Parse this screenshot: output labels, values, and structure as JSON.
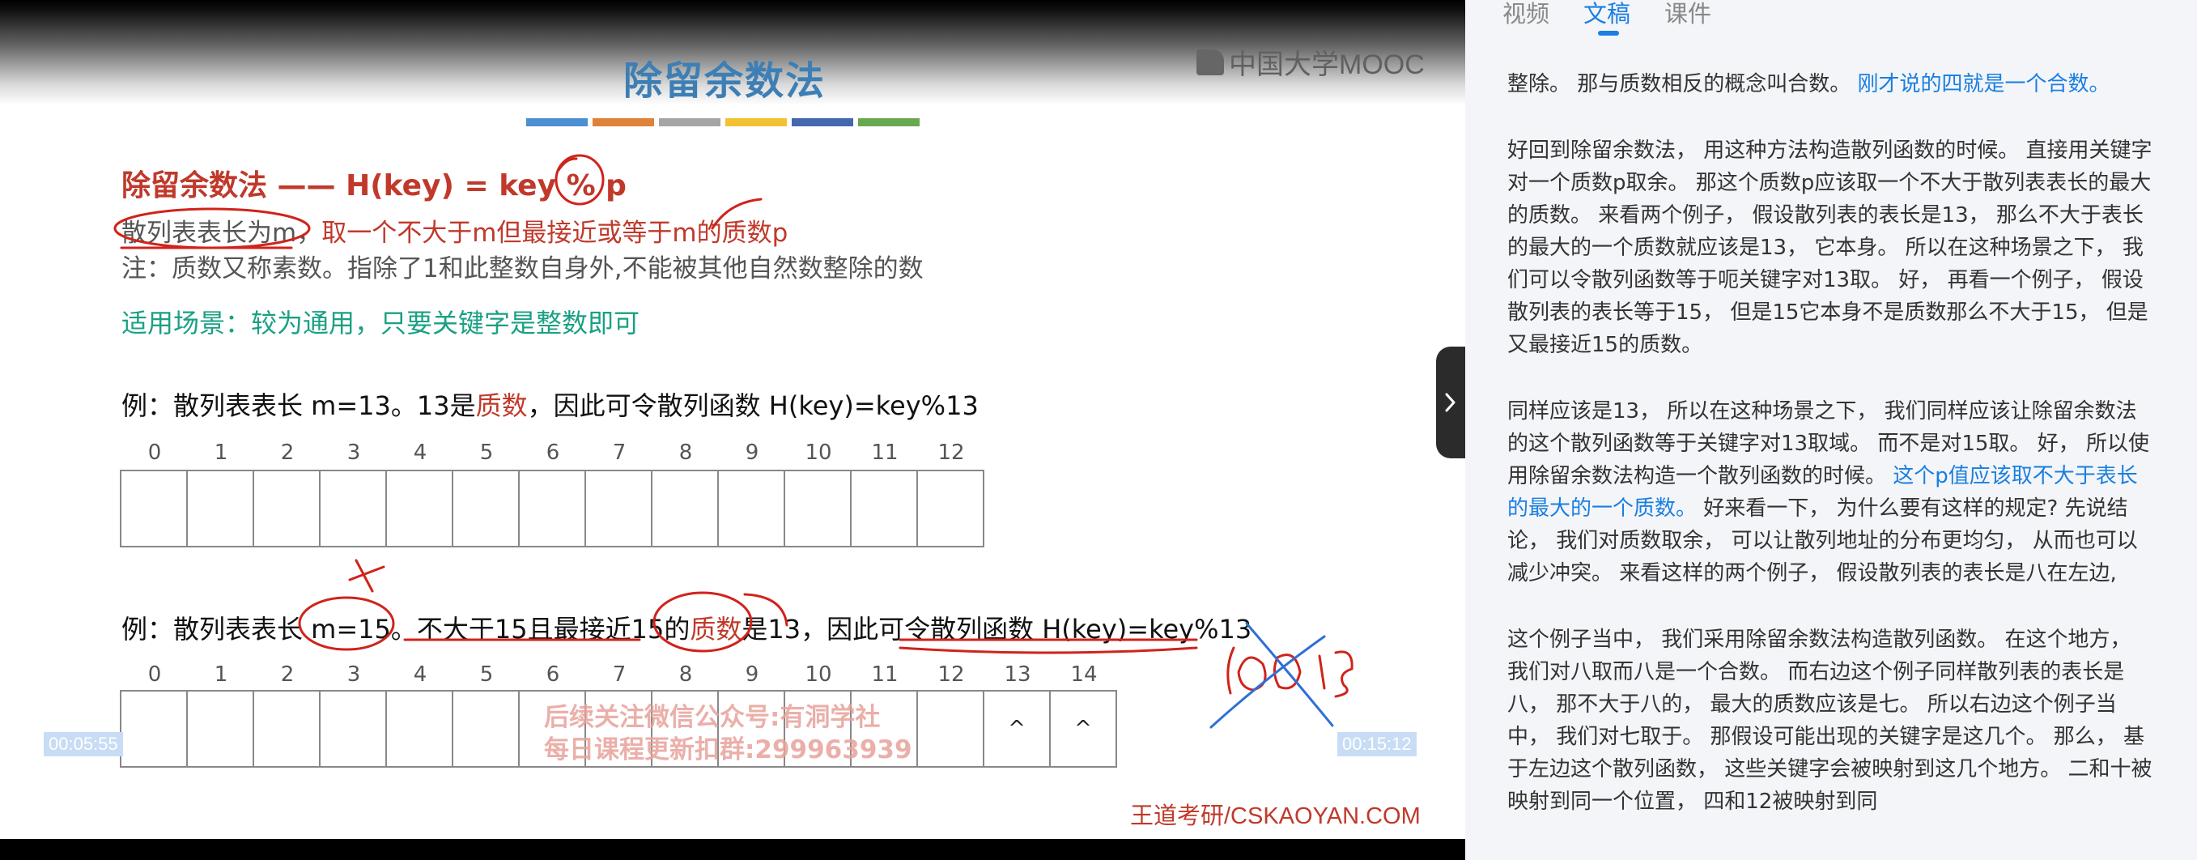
{
  "slide": {
    "title": "除留余数法",
    "formula": "除留余数法 —— H(key) = key % p",
    "line2_pre": "散列表表长为m，",
    "line2_main": "取一个不大于m但最接近或等于m的质数p",
    "note": "注：质数又称素数。指除了1和此整数自身外,不能被其他自然数整除的数",
    "scene": "适用场景：较为通用，只要关键字是整数即可",
    "example1": {
      "a": "例：散列表表长 m=13。13是",
      "red": "质数",
      "b": "，因此可令散列函数 H(key)=key%13"
    },
    "example2": {
      "a": "例：散列表表长 m=15。不大于15且最接近15的",
      "red": "质数",
      "b": "是13，因此可令散列函数 H(key)=key%13"
    },
    "table1_indices": [
      "0",
      "1",
      "2",
      "3",
      "4",
      "5",
      "6",
      "7",
      "8",
      "9",
      "10",
      "11",
      "12"
    ],
    "table2_indices": [
      "0",
      "1",
      "2",
      "3",
      "4",
      "5",
      "6",
      "7",
      "8",
      "9",
      "10",
      "11",
      "12",
      "13",
      "14"
    ],
    "table2_marks": {
      "13": "^",
      "14": "^"
    },
    "watermark_line1": "后续关注微信公众号:有洞学社",
    "watermark_line2": "每日课程更新扣群:299963939",
    "brand": "王道考研/CSKAOYAN.COM",
    "mooc_logo": "中国大学MOOC",
    "handwriting": "100 / 15",
    "stripe_colors": [
      "#4d8fd0",
      "#e0813a",
      "#a5a5a5",
      "#f1c232",
      "#4467b0",
      "#6aa84f"
    ]
  },
  "player": {
    "time_current": "00:05:55",
    "time_total": "00:15:12",
    "collapse_icon": "chevron-right-icon"
  },
  "panel": {
    "tabs": [
      {
        "label": "视频",
        "active": false
      },
      {
        "label": "文稿",
        "active": true
      },
      {
        "label": "课件",
        "active": false
      }
    ],
    "paragraphs": [
      {
        "plain1": "整除。 那与质数相反的概念叫合数。 ",
        "highlight": "刚才说的四就是一个合数。",
        "plain2": ""
      },
      {
        "plain1": "好回到除留余数法， 用这种方法构造散列函数的时候。 直接用关键字对一个质数p取余。 那这个质数p应该取一个不大于散列表表长的最大的质数。 来看两个例子， 假设散列表的表长是13， 那么不大于表长的最大的一个质数就应该是13， 它本身。 所以在这种场景之下， 我们可以令散列函数等于呃关键字对13取。 好， 再看一个例子， 假设散列表的表长等于15， 但是15它本身不是质数那么不大于15， 但是又最接近15的质数。",
        "highlight": "",
        "plain2": ""
      },
      {
        "plain1": "同样应该是13， 所以在这种场景之下， 我们同样应该让除留余数法的这个散列函数等于关键字对13取域。 而不是对15取。 好， 所以使用除留余数法构造一个散列函数的时候。 ",
        "highlight": "这个p值应该取不大于表长的最大的一个质数。",
        "plain2": " 好来看一下， 为什么要有这样的规定? 先说结论， 我们对质数取余， 可以让散列地址的分布更均匀， 从而也可以减少冲突。 来看这样的两个例子， 假设散列表的表长是八在左边,"
      },
      {
        "plain1": "这个例子当中， 我们采用除留余数法构造散列函数。 在这个地方， 我们对八取而八是一个合数。 而右边这个例子同样散列表的表长是八， 那不大于八的， 最大的质数应该是七。 所以右边这个例子当中， 我们对七取于。 那假设可能出现的关键字是这几个。 那么， 基于左边这个散列函数， 这些关键字会被映射到这几个地方。 二和十被映射到同一个位置， 四和12被映射到同",
        "highlight": "",
        "plain2": ""
      }
    ]
  }
}
